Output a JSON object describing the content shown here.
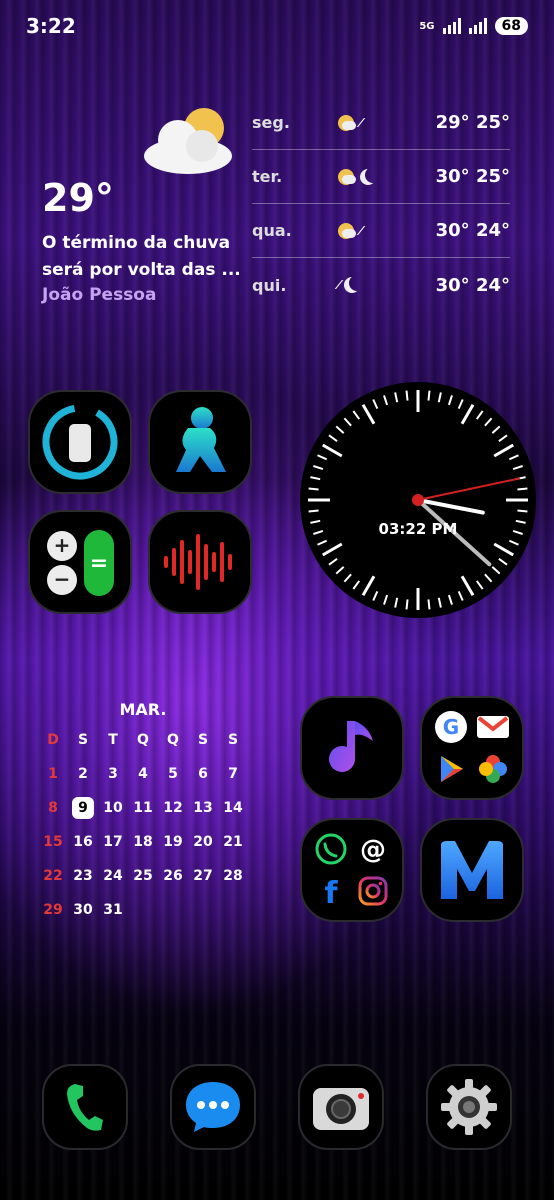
{
  "status_bar": {
    "time": "3:22",
    "battery": "68",
    "network_label": "5G"
  },
  "weather": {
    "current_temp": "29°",
    "description_line1": "O término da chuva",
    "description_line2": "será por volta das ...",
    "city": "João Pessoa",
    "forecast": [
      {
        "day": "seg.",
        "temps": "29° 25°",
        "icons": [
          "sun-cloud-icon",
          "rain-icon"
        ]
      },
      {
        "day": "ter.",
        "temps": "30° 25°",
        "icons": [
          "sun-cloud-icon",
          "moon-cloud-icon"
        ]
      },
      {
        "day": "qua.",
        "temps": "30° 24°",
        "icons": [
          "sun-cloud-icon",
          "rain-icon"
        ]
      },
      {
        "day": "qui.",
        "temps": "30° 24°",
        "icons": [
          "rain-icon",
          "moon-cloud-icon"
        ]
      }
    ]
  },
  "clock": {
    "digital_time": "03:22 PM",
    "hour": 3,
    "minute": 22,
    "second": 7
  },
  "calendar": {
    "month": "MAR.",
    "weekdays": [
      "D",
      "S",
      "T",
      "Q",
      "Q",
      "S",
      "S"
    ],
    "today": 9,
    "days": [
      "1",
      "2",
      "3",
      "4",
      "5",
      "6",
      "7",
      "8",
      "9",
      "10",
      "11",
      "12",
      "13",
      "14",
      "15",
      "16",
      "17",
      "18",
      "19",
      "20",
      "21",
      "22",
      "23",
      "24",
      "25",
      "26",
      "27",
      "28",
      "29",
      "30",
      "31"
    ]
  },
  "apps": {
    "row1": [
      "device-care-icon",
      "fitness-icon"
    ],
    "row2": [
      "calculator-icon",
      "voice-recorder-icon"
    ],
    "music": "music-icon",
    "google_folder": [
      "google-icon",
      "gmail-icon",
      "play-store-icon",
      "photos-icon"
    ],
    "social_folder": [
      "whatsapp-icon",
      "threads-icon",
      "facebook-icon",
      "instagram-icon"
    ],
    "m_app": "m-app-icon"
  },
  "dock": [
    "phone-icon",
    "messages-icon",
    "camera-icon",
    "settings-icon"
  ],
  "colors": {
    "accent_purple": "#8a2be2",
    "calendar_sunday": "#e23a3a",
    "city_text": "#c4a3f0"
  }
}
